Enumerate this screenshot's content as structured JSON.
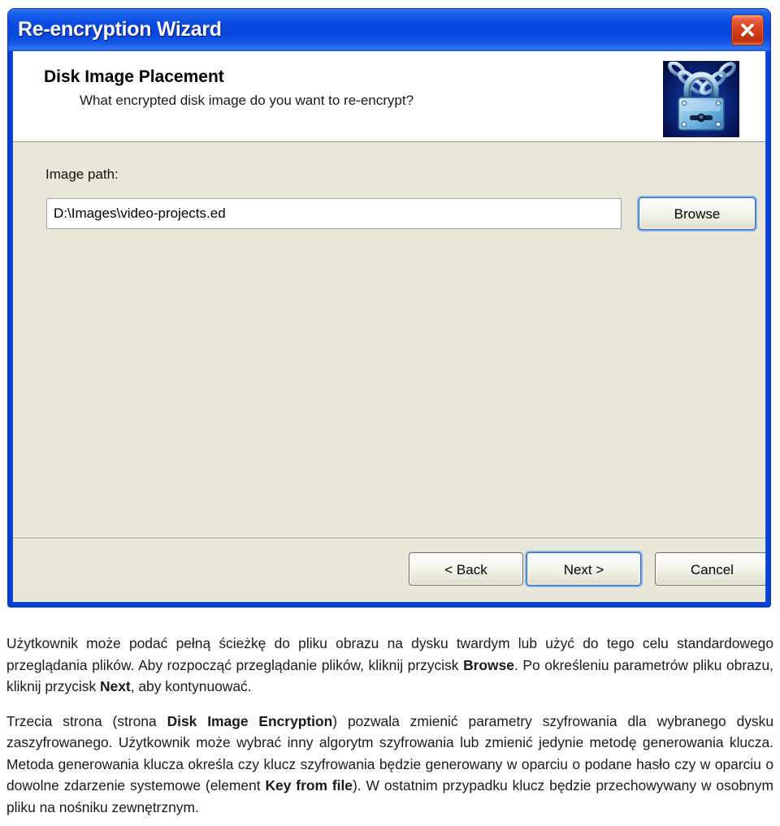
{
  "window": {
    "title": "Re-encryption Wizard",
    "close_label": "×",
    "icon_name": "padlock-with-chain-icon",
    "accent_color": "#0a45da",
    "body_color": "#e9e7d8",
    "close_color": "#d33c18"
  },
  "header": {
    "title": "Disk Image Placement",
    "subtitle": "What encrypted disk image do you want to re-encrypt?"
  },
  "form": {
    "path_label": "Image path:",
    "path_value": "D:\\Images\\video-projects.ed",
    "path_placeholder": "D:\\Images\\video-projects.ed",
    "browse_label": "Browse"
  },
  "footer": {
    "back_label": "< Back",
    "next_label": "Next >",
    "cancel_label": "Cancel"
  },
  "document": {
    "paragraph1_part1": "Użytkownik może podać pełną ścieżkę do pliku obrazu na dysku twardym lub użyć do tego celu standardowego przeglądania plików. Aby rozpocząć przeglądanie plików, kliknij przycisk ",
    "paragraph1_bold1": "Browse",
    "paragraph1_part2": ". Po określeniu parametrów pliku obrazu, kliknij przycisk ",
    "paragraph1_bold2": "Next",
    "paragraph1_part3": ", aby kontynuować.",
    "paragraph2_part1": "Trzecia strona (strona ",
    "paragraph2_bold1": "Disk Image Encryption",
    "paragraph2_part2": ") pozwala zmienić parametry szyfrowania dla wybranego dysku zaszyfrowanego. Użytkownik może wybrać inny algorytm szyfrowania lub zmienić jedynie metodę generowania klucza. Metoda generowania klucza określa czy klucz szyfrowania będzie generowany w oparciu o podane hasło czy w oparciu o dowolne zdarzenie systemowe (element ",
    "paragraph2_bold2": "Key from file",
    "paragraph2_part3": "). W ostatnim przypadku klucz będzie przechowywany w osobnym pliku na nośniku zewnętrznym."
  }
}
